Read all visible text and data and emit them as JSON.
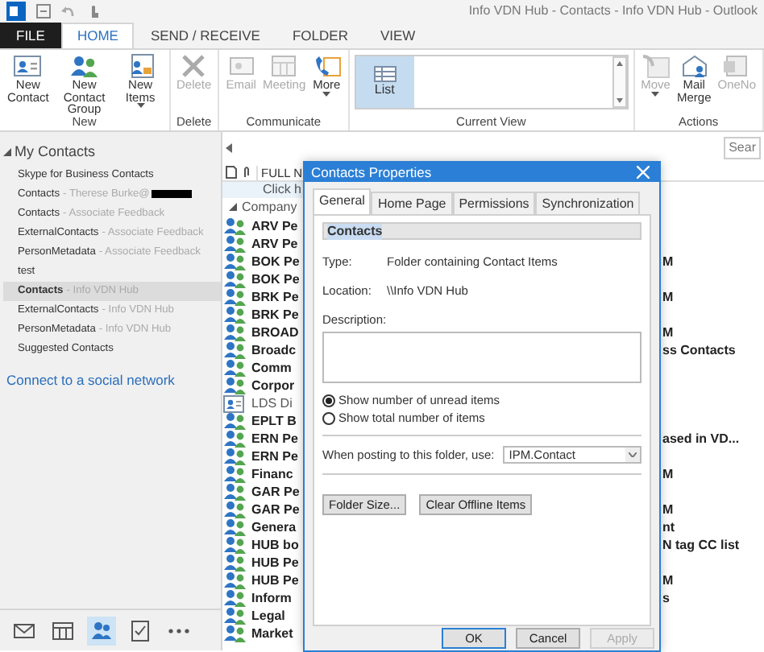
{
  "window": {
    "title": "Info VDN Hub - Contacts - Info VDN Hub - Outlook"
  },
  "ribbon": {
    "tabs": [
      {
        "label": "FILE",
        "kind": "file",
        "selected": false
      },
      {
        "label": "HOME",
        "kind": "tab",
        "selected": true
      },
      {
        "label": "SEND / RECEIVE",
        "kind": "tab",
        "selected": false
      },
      {
        "label": "FOLDER",
        "kind": "tab",
        "selected": false
      },
      {
        "label": "VIEW",
        "kind": "tab",
        "selected": false
      }
    ],
    "groups": [
      {
        "label": "New",
        "kind": "buttons",
        "buttons": [
          {
            "label": "New Contact",
            "disabled": false,
            "dropdown": false
          },
          {
            "label": "New Contact Group",
            "disabled": false,
            "dropdown": false
          },
          {
            "label": "New Items",
            "disabled": false,
            "dropdown": true
          }
        ]
      },
      {
        "label": "Delete",
        "kind": "buttons",
        "buttons": [
          {
            "label": "Delete",
            "disabled": true,
            "dropdown": false
          }
        ]
      },
      {
        "label": "Communicate",
        "kind": "buttons",
        "buttons": [
          {
            "label": "Email",
            "disabled": true,
            "dropdown": false
          },
          {
            "label": "Meeting",
            "disabled": true,
            "dropdown": false
          },
          {
            "label": "More",
            "disabled": false,
            "dropdown": true
          }
        ]
      },
      {
        "label": "Current View",
        "kind": "gallery",
        "items": [
          {
            "label": "List",
            "selected": true
          }
        ]
      },
      {
        "label": "Actions",
        "kind": "buttons",
        "buttons": [
          {
            "label": "Move",
            "disabled": true,
            "dropdown": true
          },
          {
            "label": "Mail Merge",
            "disabled": false,
            "dropdown": false
          },
          {
            "label": "OneNo",
            "disabled": true,
            "dropdown": false
          }
        ]
      }
    ]
  },
  "search": {
    "placeholder": "Sear"
  },
  "folder_pane": {
    "header": "My Contacts",
    "expanded": true,
    "items": [
      {
        "name": "Skype for Business Contacts",
        "selected": false,
        "redacted": false
      },
      {
        "name": "Contacts",
        "account": "- Therese Burke@",
        "selected": false,
        "redacted": true
      },
      {
        "name": "Contacts",
        "account": "- Associate Feedback",
        "selected": false,
        "redacted": false
      },
      {
        "name": "ExternalContacts",
        "account": "- Associate Feedback",
        "selected": false,
        "redacted": false
      },
      {
        "name": "PersonMetadata",
        "account": "- Associate Feedback",
        "selected": false,
        "redacted": false
      },
      {
        "name": "test",
        "selected": false,
        "redacted": false
      },
      {
        "name": "Contacts",
        "account": "- Info VDN Hub",
        "selected": true,
        "redacted": false
      },
      {
        "name": "ExternalContacts",
        "account": "- Info VDN Hub",
        "selected": false,
        "redacted": false
      },
      {
        "name": "PersonMetadata",
        "account": "- Info VDN Hub",
        "selected": false,
        "redacted": false
      },
      {
        "name": "Suggested Contacts",
        "selected": false,
        "redacted": false
      }
    ],
    "link": "Connect to a social network"
  },
  "nav_bar": [
    {
      "selected": false
    },
    {
      "selected": false
    },
    {
      "selected": true
    },
    {
      "selected": false
    },
    {
      "selected": false
    }
  ],
  "contact_list": {
    "header": "FULL N",
    "new_row": "Click h",
    "group": {
      "label": "Company",
      "expanded": true
    },
    "rows": [
      {
        "kind": "group",
        "name": "ARV Pe"
      },
      {
        "kind": "group",
        "name": "ARV Pe"
      },
      {
        "kind": "group",
        "name": "BOK Pe",
        "column_3": "M"
      },
      {
        "kind": "group",
        "name": "BOK Pe"
      },
      {
        "kind": "group",
        "name": "BRK Pe",
        "column_3": "M"
      },
      {
        "kind": "group",
        "name": "BRK Pe"
      },
      {
        "kind": "group",
        "name": "BROAD",
        "column_3": "M"
      },
      {
        "kind": "group",
        "name": "Broadc",
        "column_3": "ss Contacts"
      },
      {
        "kind": "group",
        "name": "Comm"
      },
      {
        "kind": "group",
        "name": "Corpor"
      },
      {
        "kind": "contact",
        "name": "LDS Di"
      },
      {
        "kind": "group",
        "name": "EPLT B"
      },
      {
        "kind": "group",
        "name": "ERN Pe",
        "column_3": "ased in VD..."
      },
      {
        "kind": "group",
        "name": "ERN Pe"
      },
      {
        "kind": "group",
        "name": "Financ",
        "column_3": "M"
      },
      {
        "kind": "group",
        "name": "GAR Pe"
      },
      {
        "kind": "group",
        "name": "GAR Pe",
        "column_3": "M"
      },
      {
        "kind": "group",
        "name": "Genera",
        "column_3": "nt"
      },
      {
        "kind": "group",
        "name": "HUB bo",
        "column_3": "N tag CC list"
      },
      {
        "kind": "group",
        "name": "HUB Pe"
      },
      {
        "kind": "group",
        "name": "HUB Pe",
        "column_3": "M"
      },
      {
        "kind": "group",
        "name": "Inform",
        "column_3": "s"
      },
      {
        "kind": "group",
        "name": "Legal"
      },
      {
        "kind": "group",
        "name": "Market"
      }
    ]
  },
  "dialog": {
    "title": "Contacts Properties",
    "tabs": [
      {
        "label": "General",
        "selected": true
      },
      {
        "label": "Home Page",
        "selected": false
      },
      {
        "label": "Permissions",
        "selected": false
      },
      {
        "label": "Synchronization",
        "selected": false
      }
    ],
    "name": "Contacts",
    "fields": [
      {
        "label": "Type:",
        "value": "Folder containing Contact Items"
      },
      {
        "label": "Location:",
        "value": "\\\\Info VDN Hub"
      }
    ],
    "description_label": "Description:",
    "radios": [
      {
        "label": "Show number of unread items",
        "selected": true
      },
      {
        "label": "Show total number of items",
        "selected": false
      }
    ],
    "posting": {
      "label": "When posting to this folder, use:",
      "value": "IPM.Contact"
    },
    "buttons": [
      "Folder Size...",
      "Clear Offline Items"
    ],
    "footer_buttons": [
      {
        "label": "OK",
        "disabled": false,
        "default": true
      },
      {
        "label": "Cancel",
        "disabled": false,
        "default": false
      },
      {
        "label": "Apply",
        "disabled": true,
        "default": false
      }
    ]
  }
}
